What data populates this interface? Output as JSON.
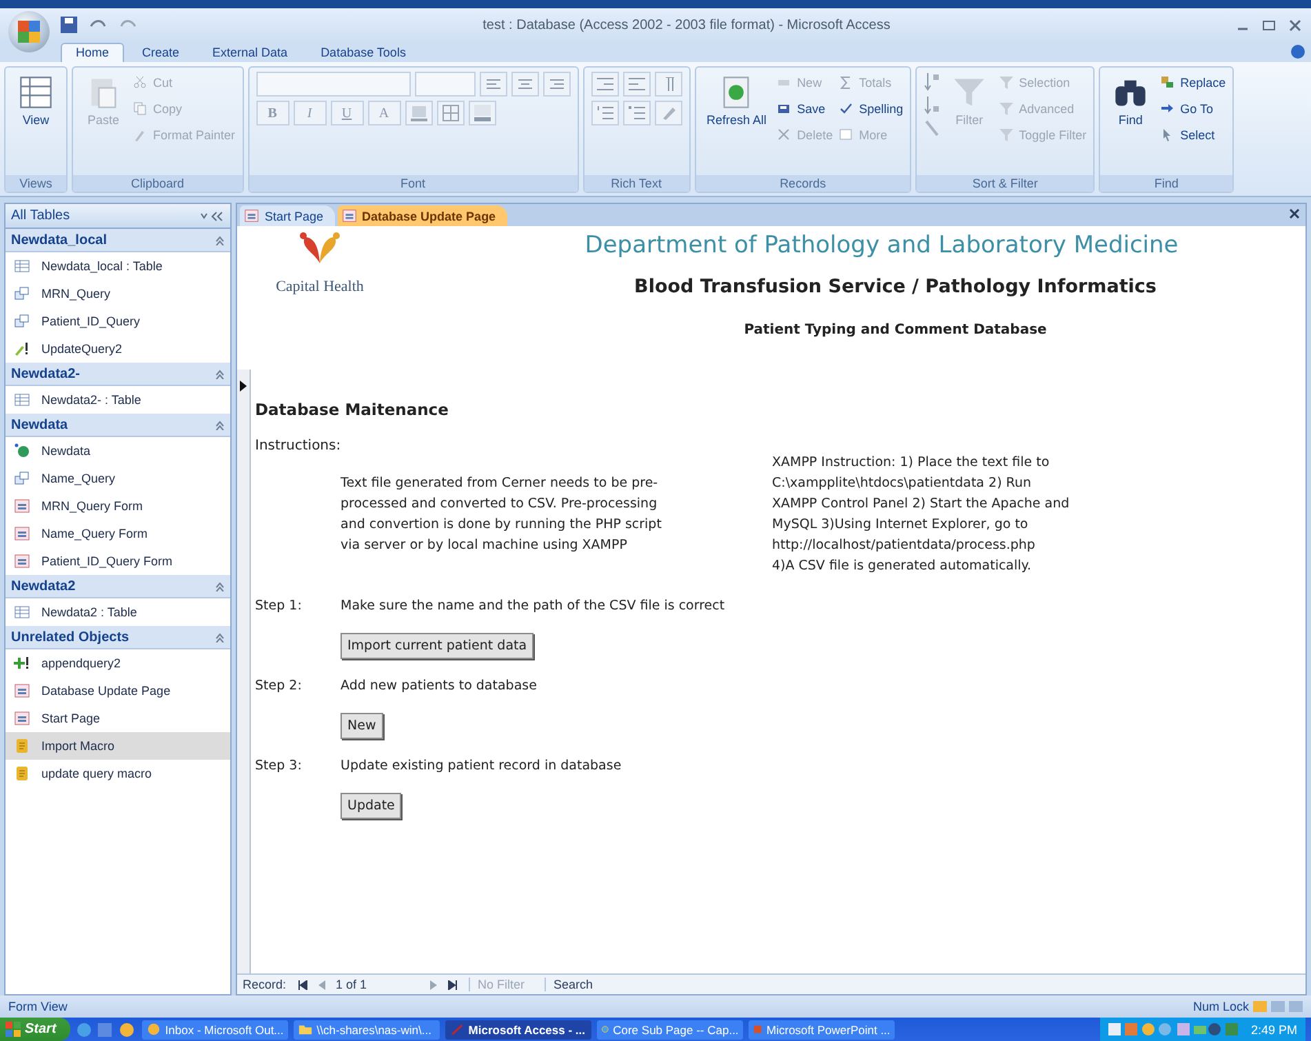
{
  "window": {
    "title": "test : Database (Access 2002 - 2003 file format) - Microsoft Access"
  },
  "ribbon_tabs": [
    {
      "label": "Home",
      "selected": true
    },
    {
      "label": "Create",
      "selected": false
    },
    {
      "label": "External Data",
      "selected": false
    },
    {
      "label": "Database Tools",
      "selected": false
    }
  ],
  "ribbon_groups": [
    {
      "label": "Views",
      "kind": "buttons",
      "items": [
        {
          "label": "View",
          "kind": "large",
          "disabled": false
        }
      ]
    },
    {
      "label": "Clipboard",
      "kind": "buttons",
      "items": [
        {
          "label": "Paste",
          "kind": "large",
          "disabled": true
        },
        {
          "label": "Cut",
          "kind": "small",
          "disabled": true
        },
        {
          "label": "Copy",
          "kind": "small",
          "disabled": true
        },
        {
          "label": "Format Painter",
          "kind": "small",
          "disabled": true
        }
      ]
    },
    {
      "label": "Font",
      "kind": "font",
      "format_buttons": [
        "B",
        "I",
        "U",
        "A"
      ]
    },
    {
      "label": "Rich Text",
      "kind": "richtext"
    },
    {
      "label": "Records",
      "kind": "buttons",
      "items": [
        {
          "label": "Refresh All",
          "kind": "large",
          "disabled": false
        },
        {
          "label": "New",
          "kind": "small",
          "disabled": true
        },
        {
          "label": "Save",
          "kind": "small",
          "disabled": false
        },
        {
          "label": "Delete",
          "kind": "small",
          "disabled": true
        },
        {
          "label": "Totals",
          "kind": "small",
          "disabled": true
        },
        {
          "label": "Spelling",
          "kind": "small",
          "disabled": false
        },
        {
          "label": "More",
          "kind": "small",
          "disabled": true
        }
      ]
    },
    {
      "label": "Sort & Filter",
      "kind": "sort",
      "items": [
        {
          "label": "Filter",
          "kind": "large",
          "disabled": true
        },
        {
          "label": "Selection",
          "kind": "small",
          "disabled": true
        },
        {
          "label": "Advanced",
          "kind": "small",
          "disabled": true
        },
        {
          "label": "Toggle Filter",
          "kind": "small",
          "disabled": true
        }
      ]
    },
    {
      "label": "Find",
      "kind": "buttons",
      "items": [
        {
          "label": "Find",
          "kind": "large",
          "disabled": false
        },
        {
          "label": "Replace",
          "kind": "small",
          "disabled": false
        },
        {
          "label": "Go To",
          "kind": "small",
          "disabled": false
        },
        {
          "label": "Select",
          "kind": "small",
          "disabled": false
        }
      ]
    }
  ],
  "navigation": {
    "header": "All Tables",
    "groups": [
      {
        "title": "Newdata_local",
        "items": [
          {
            "label": "Newdata_local : Table",
            "kind": "table",
            "selected": false
          },
          {
            "label": "MRN_Query",
            "kind": "query",
            "selected": false
          },
          {
            "label": "Patient_ID_Query",
            "kind": "query",
            "selected": false
          },
          {
            "label": "UpdateQuery2",
            "kind": "update",
            "selected": false
          }
        ]
      },
      {
        "title": "Newdata2-",
        "items": [
          {
            "label": "Newdata2- : Table",
            "kind": "table",
            "selected": false
          }
        ]
      },
      {
        "title": "Newdata",
        "items": [
          {
            "label": "Newdata",
            "kind": "linked",
            "selected": false
          },
          {
            "label": "Name_Query",
            "kind": "query",
            "selected": false
          },
          {
            "label": "MRN_Query Form",
            "kind": "form",
            "selected": false
          },
          {
            "label": "Name_Query Form",
            "kind": "form",
            "selected": false
          },
          {
            "label": "Patient_ID_Query Form",
            "kind": "form",
            "selected": false
          }
        ]
      },
      {
        "title": "Newdata2",
        "items": [
          {
            "label": "Newdata2 : Table",
            "kind": "table",
            "selected": false
          }
        ]
      },
      {
        "title": "Unrelated Objects",
        "items": [
          {
            "label": "appendquery2",
            "kind": "append",
            "selected": false
          },
          {
            "label": "Database Update Page",
            "kind": "form",
            "selected": false
          },
          {
            "label": "Start Page",
            "kind": "form",
            "selected": false
          },
          {
            "label": "Import Macro",
            "kind": "macro",
            "selected": true
          },
          {
            "label": "update query macro",
            "kind": "macro",
            "selected": false
          }
        ]
      }
    ]
  },
  "document_tabs": [
    {
      "label": "Start Page",
      "selected": false
    },
    {
      "label": "Database Update Page",
      "selected": true
    }
  ],
  "form": {
    "logo_text": "Capital Health",
    "title": "Department of Pathology and Laboratory Medicine",
    "subtitle": "Blood Transfusion Service / Pathology Informatics",
    "heading": "Patient Typing and Comment Database",
    "section": "Database Maitenance",
    "instructions_label": "Instructions:",
    "instructions": "Text file generated from Cerner needs to be pre-\nprocessed and converted to CSV.  Pre-processing\nand convertion is done by running the PHP script\nvia server or by local machine using XAMPP",
    "xampp_note": "XAMPP Instruction: 1) Place the text file to\nC:\\xampplite\\htdocs\\patientdata 2) Run\nXAMPP Control Panel 2) Start the Apache and\nMySQL 3)Using Internet Explorer, go to\nhttp://localhost/patientdata/process.php\n4)A CSV file is generated automatically.",
    "steps": [
      {
        "label": "Step 1:",
        "text": "Make sure the name and the path of the CSV file is correct",
        "button": "Import current patient data"
      },
      {
        "label": "Step 2:",
        "text": "Add new patients to database",
        "button": "New"
      },
      {
        "label": "Step 3:",
        "text": "Update existing patient record in database",
        "button": "Update"
      }
    ]
  },
  "record_nav": {
    "label": "Record:",
    "position": "1 of 1",
    "filter": "No Filter",
    "search": "Search"
  },
  "status_bar": {
    "left": "Form View",
    "right": "Num Lock"
  },
  "taskbar": {
    "start": "Start",
    "tasks": [
      {
        "label": "Inbox - Microsoft Out...",
        "selected": false
      },
      {
        "label": "\\\\ch-shares\\nas-win\\...",
        "selected": false
      },
      {
        "label": "Microsoft Access - ...",
        "selected": true
      },
      {
        "label": "Core Sub Page -- Cap...",
        "selected": false
      },
      {
        "label": "Microsoft PowerPoint ...",
        "selected": false
      }
    ],
    "clock": "2:49 PM"
  }
}
